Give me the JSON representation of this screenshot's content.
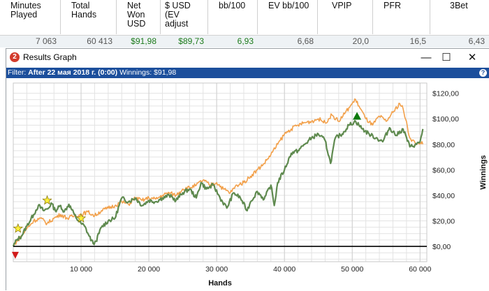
{
  "stats": {
    "headers": [
      "Minutes\nPlayed",
      "Total\nHands",
      "Net\nWon\nUSD",
      "$ USD\n(EV\nadjust",
      "bb/100",
      "EV bb/100",
      "VPIP",
      "PFR",
      "3Bet"
    ],
    "values": [
      "7 063",
      "60 413",
      "$91,98",
      "$89,73",
      "6,93",
      "6,68",
      "20,0",
      "16,5",
      "6,43"
    ]
  },
  "window": {
    "icon_label": "2",
    "title": "Results Graph",
    "minimize": "—",
    "maximize": "☐",
    "close": "✕"
  },
  "filter": {
    "prefix": "Filter:",
    "text": "After 22 мая 2018 г. (0:00)",
    "winnings_label": "Winnings:",
    "winnings_value": "$91,98",
    "help": "?"
  },
  "colors": {
    "winnings": "#5f8a4f",
    "ev_winnings": "#f2a04a",
    "zero_line": "#000000",
    "filter_bar": "#1c4f9c",
    "grid": "#e3e3e3"
  },
  "chart_data": {
    "type": "line",
    "xlabel": "Hands",
    "ylabel": "Winnings",
    "xlim": [
      0,
      61000
    ],
    "ylim": [
      -12,
      128
    ],
    "x_ticks": [
      10000,
      20000,
      30000,
      40000,
      50000,
      60000
    ],
    "x_tick_labels": [
      "10 000",
      "20 000",
      "30 000",
      "40 000",
      "50 000",
      "60 000"
    ],
    "y_ticks": [
      0,
      20,
      40,
      60,
      80,
      100,
      120
    ],
    "y_tick_labels": [
      "$0,00",
      "$20,00",
      "$40,00",
      "$60,00",
      "$80,00",
      "$100,00",
      "$120,00"
    ],
    "grid": true,
    "series": [
      {
        "role": "winnings",
        "x": [
          0,
          500,
          1200,
          2000,
          3000,
          3700,
          4500,
          5200,
          5600,
          6200,
          7000,
          7500,
          8200,
          9000,
          9600,
          10000,
          10500,
          11200,
          11800,
          12200,
          13000,
          14000,
          15000,
          16000,
          17000,
          18000,
          19000,
          20000,
          21000,
          22000,
          23000,
          24000,
          25000,
          26000,
          27000,
          27700,
          28500,
          29500,
          30500,
          31500,
          32500,
          33500,
          34500,
          35000,
          36000,
          37000,
          38000,
          38500,
          39000,
          40000,
          41000,
          42000,
          43000,
          44000,
          45000,
          46000,
          46800,
          47500,
          48500,
          49500,
          50500,
          51500,
          52500,
          53500,
          54500,
          55500,
          56500,
          57500,
          58500,
          59500,
          60000,
          60413
        ],
        "y": [
          0,
          5,
          8,
          16,
          25,
          32,
          28,
          30,
          34,
          28,
          32,
          27,
          33,
          25,
          20,
          18,
          16,
          8,
          2,
          4,
          15,
          20,
          22,
          38,
          35,
          38,
          32,
          36,
          35,
          38,
          40,
          36,
          42,
          45,
          38,
          50,
          45,
          48,
          38,
          30,
          42,
          38,
          28,
          35,
          43,
          37,
          48,
          32,
          50,
          60,
          73,
          75,
          80,
          85,
          88,
          83,
          65,
          85,
          88,
          95,
          98,
          92,
          88,
          85,
          82,
          93,
          87,
          92,
          78,
          80,
          82,
          92
        ]
      },
      {
        "role": "ev_winnings",
        "x": [
          0,
          500,
          1200,
          2000,
          3000,
          4000,
          5000,
          6000,
          7000,
          8000,
          9000,
          10000,
          11000,
          12000,
          13000,
          14000,
          15000,
          16000,
          17000,
          18000,
          19000,
          20000,
          21000,
          22000,
          23000,
          24000,
          25000,
          26000,
          27000,
          28000,
          29000,
          30000,
          31000,
          32000,
          33000,
          34000,
          35000,
          36000,
          37000,
          38000,
          39000,
          40000,
          41000,
          42000,
          43000,
          44000,
          45000,
          46000,
          47000,
          48000,
          49000,
          50000,
          50500,
          51000,
          52000,
          53000,
          54000,
          55000,
          56000,
          57000,
          57500,
          58500,
          59500,
          60000,
          60413
        ],
        "y": [
          0,
          4,
          8,
          14,
          20,
          22,
          18,
          22,
          25,
          22,
          24,
          25,
          27,
          24,
          28,
          30,
          32,
          35,
          33,
          38,
          36,
          38,
          37,
          40,
          42,
          40,
          45,
          46,
          48,
          52,
          48,
          50,
          45,
          42,
          48,
          50,
          55,
          60,
          65,
          72,
          80,
          88,
          92,
          95,
          97,
          98,
          100,
          97,
          103,
          98,
          105,
          112,
          115,
          110,
          100,
          95,
          102,
          98,
          105,
          112,
          108,
          85,
          80,
          82,
          80
        ]
      }
    ],
    "markers": [
      {
        "kind": "star",
        "x": 700,
        "y": 14
      },
      {
        "kind": "star",
        "x": 5000,
        "y": 36
      },
      {
        "kind": "star",
        "x": 10000,
        "y": 22
      },
      {
        "kind": "triangle-up",
        "x": 50700,
        "y": 102
      },
      {
        "kind": "triangle-down",
        "x": 300,
        "y": -7
      }
    ]
  }
}
